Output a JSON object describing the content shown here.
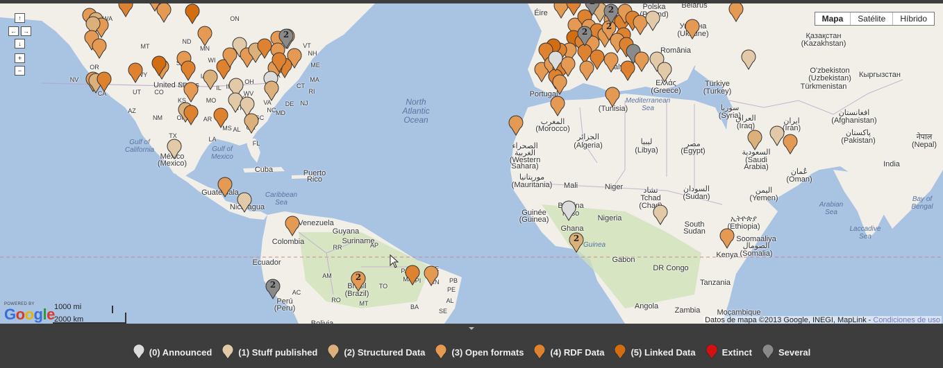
{
  "map_type_control": {
    "buttons": [
      {
        "label": "Mapa",
        "active": true
      },
      {
        "label": "Satélite",
        "active": false
      },
      {
        "label": "Híbrido",
        "active": false
      }
    ]
  },
  "navigation": {
    "up": "↑",
    "left": "←",
    "right": "→",
    "down": "↓",
    "zoom_in": "+",
    "zoom_out": "−"
  },
  "branding": {
    "powered_by": "POWERED BY",
    "google": [
      "G",
      "o",
      "o",
      "g",
      "l",
      "e"
    ]
  },
  "scale": {
    "imperial": "1000 mi",
    "metric": "2000 km"
  },
  "attribution": {
    "text": "Datos de mapa ©2013 Google, INEGI, MapLink - ",
    "link": "Condiciones de uso"
  },
  "colors": {
    "ocean": "#a9c3e3",
    "land": "#f2efe9",
    "vegetation": "#cfe1b5",
    "announced": "#dcdcdc",
    "stuff_published": "#e2c9a8",
    "structured_data": "#dcb07a",
    "open_formats": "#e49a52",
    "rdf_data": "#df8230",
    "linked_data": "#d36d12",
    "extinct": "#d41010",
    "several": "#8a8a8a"
  },
  "legend": [
    {
      "label": "(0) Announced",
      "color": "#dcdcdc"
    },
    {
      "label": "(1) Stuff published",
      "color": "#e2c9a8"
    },
    {
      "label": "(2) Structured Data",
      "color": "#dcb07a"
    },
    {
      "label": "(3) Open formats",
      "color": "#e49a52"
    },
    {
      "label": "(4) RDF Data",
      "color": "#df8230"
    },
    {
      "label": "(5) Linked Data",
      "color": "#d36d12"
    },
    {
      "label": "Extinct",
      "color": "#d41010"
    },
    {
      "label": "Several",
      "color": "#8a8a8a"
    }
  ],
  "labels": {
    "oceans": [
      "North",
      "Atlantic",
      "Ocean"
    ],
    "gulf_ca": [
      "Gulf of",
      "California"
    ],
    "gulf_mx": [
      "Gulf of",
      "Mexico"
    ],
    "caribbean": [
      "Caribbean",
      "Sea"
    ],
    "mediterranean": [
      "Mediterranean",
      "Sea"
    ],
    "arabian": [
      "Arabian",
      "Sea"
    ],
    "bengal": [
      "Bay of",
      "Bengal"
    ],
    "laccadive": [
      "Laccadive",
      "Sea"
    ],
    "gulf_guinea": "Guinea",
    "countries": [
      "United States",
      "México",
      "(Mexico)",
      "Cuba",
      "Puerto",
      "Rico",
      "Guatemala",
      "Nicaragua",
      "Venezuela",
      "Guyana",
      "Suriname",
      "Colombia",
      "Ecuador",
      "Perú",
      "(Peru)",
      "Brasil",
      "(Brazil)",
      "Bolivia",
      "Portugal",
      "المغرب",
      "(Morocco)",
      "الصحراء",
      "الغربية",
      "(Western",
      "Sahara)",
      "الجزائر",
      "(Algeria)",
      "ليبيا",
      "(Libya)",
      "مصر",
      "(Egypt)",
      "موريتانيا",
      "(Mauritania)",
      "Mali",
      "Niger",
      "تشاد",
      "Tchad",
      "(Chad)",
      "السودان",
      "(Sudan)",
      "Guinée",
      "(Guinea)",
      "Burkina",
      "Faso",
      "Ghana",
      "Nigeria",
      "South",
      "Sudan",
      "ኢትዮጵያ",
      "(Ethiopia)",
      "Soomaaliya",
      "الصومال",
      "(Somalia)",
      "Kenya",
      "Gabon",
      "DR Congo",
      "Tanzania",
      "Angola",
      "Zambia",
      "Moçambique",
      "(Tunisia)",
      "Éire",
      "Polska",
      "(Poland)",
      "Україна",
      "(Ukraine)",
      "România",
      "Ελλάς",
      "(Greece)",
      "Italy",
      "Türkiye",
      "(Turkey)",
      "سوريا",
      "(Syria)",
      "العراق",
      "(Iraq)",
      "ایران",
      "(Iran)",
      "السعودية",
      "(Saudi",
      "Arabia)",
      "اليمن",
      "(Yemen)",
      "عُمان",
      "(Oman)",
      "Қазақстан",
      "(Kazakhstan)",
      "O'zbekiston",
      "(Uzbekistan)",
      "Кыргызстан",
      "Türkmenistan",
      "افغانستان",
      "(Afghanistan)",
      "پاکستان",
      "(Pakistan)",
      "नेपाल",
      "(Nepal)",
      "India",
      "Belarus"
    ],
    "us_states": [
      "WA",
      "MT",
      "ND",
      "MN",
      "ON",
      "OR",
      "ID",
      "WY",
      "SD",
      "IA",
      "UT",
      "CO",
      "NE",
      "KS",
      "MO",
      "CA",
      "AZ",
      "NM",
      "OK",
      "AR",
      "TX",
      "LA",
      "MS",
      "AL",
      "GA",
      "FL",
      "SC",
      "NC",
      "TN",
      "KY",
      "VA",
      "WV",
      "OH",
      "IN",
      "IL",
      "MI",
      "WI",
      "PA",
      "NY",
      "VT",
      "NH",
      "ME",
      "MA",
      "CT",
      "RI",
      "NJ",
      "DE",
      "MD",
      "NV"
    ],
    "br_states": [
      "AC",
      "RO",
      "MT",
      "PA",
      "MA",
      "RN",
      "PB",
      "PE",
      "AL",
      "SE",
      "BA",
      "TO",
      "PI",
      "CE",
      "AM",
      "RR",
      "AP"
    ]
  },
  "clusters": [
    "2",
    "2",
    "2",
    "2",
    "2",
    "2",
    "2",
    "2"
  ]
}
